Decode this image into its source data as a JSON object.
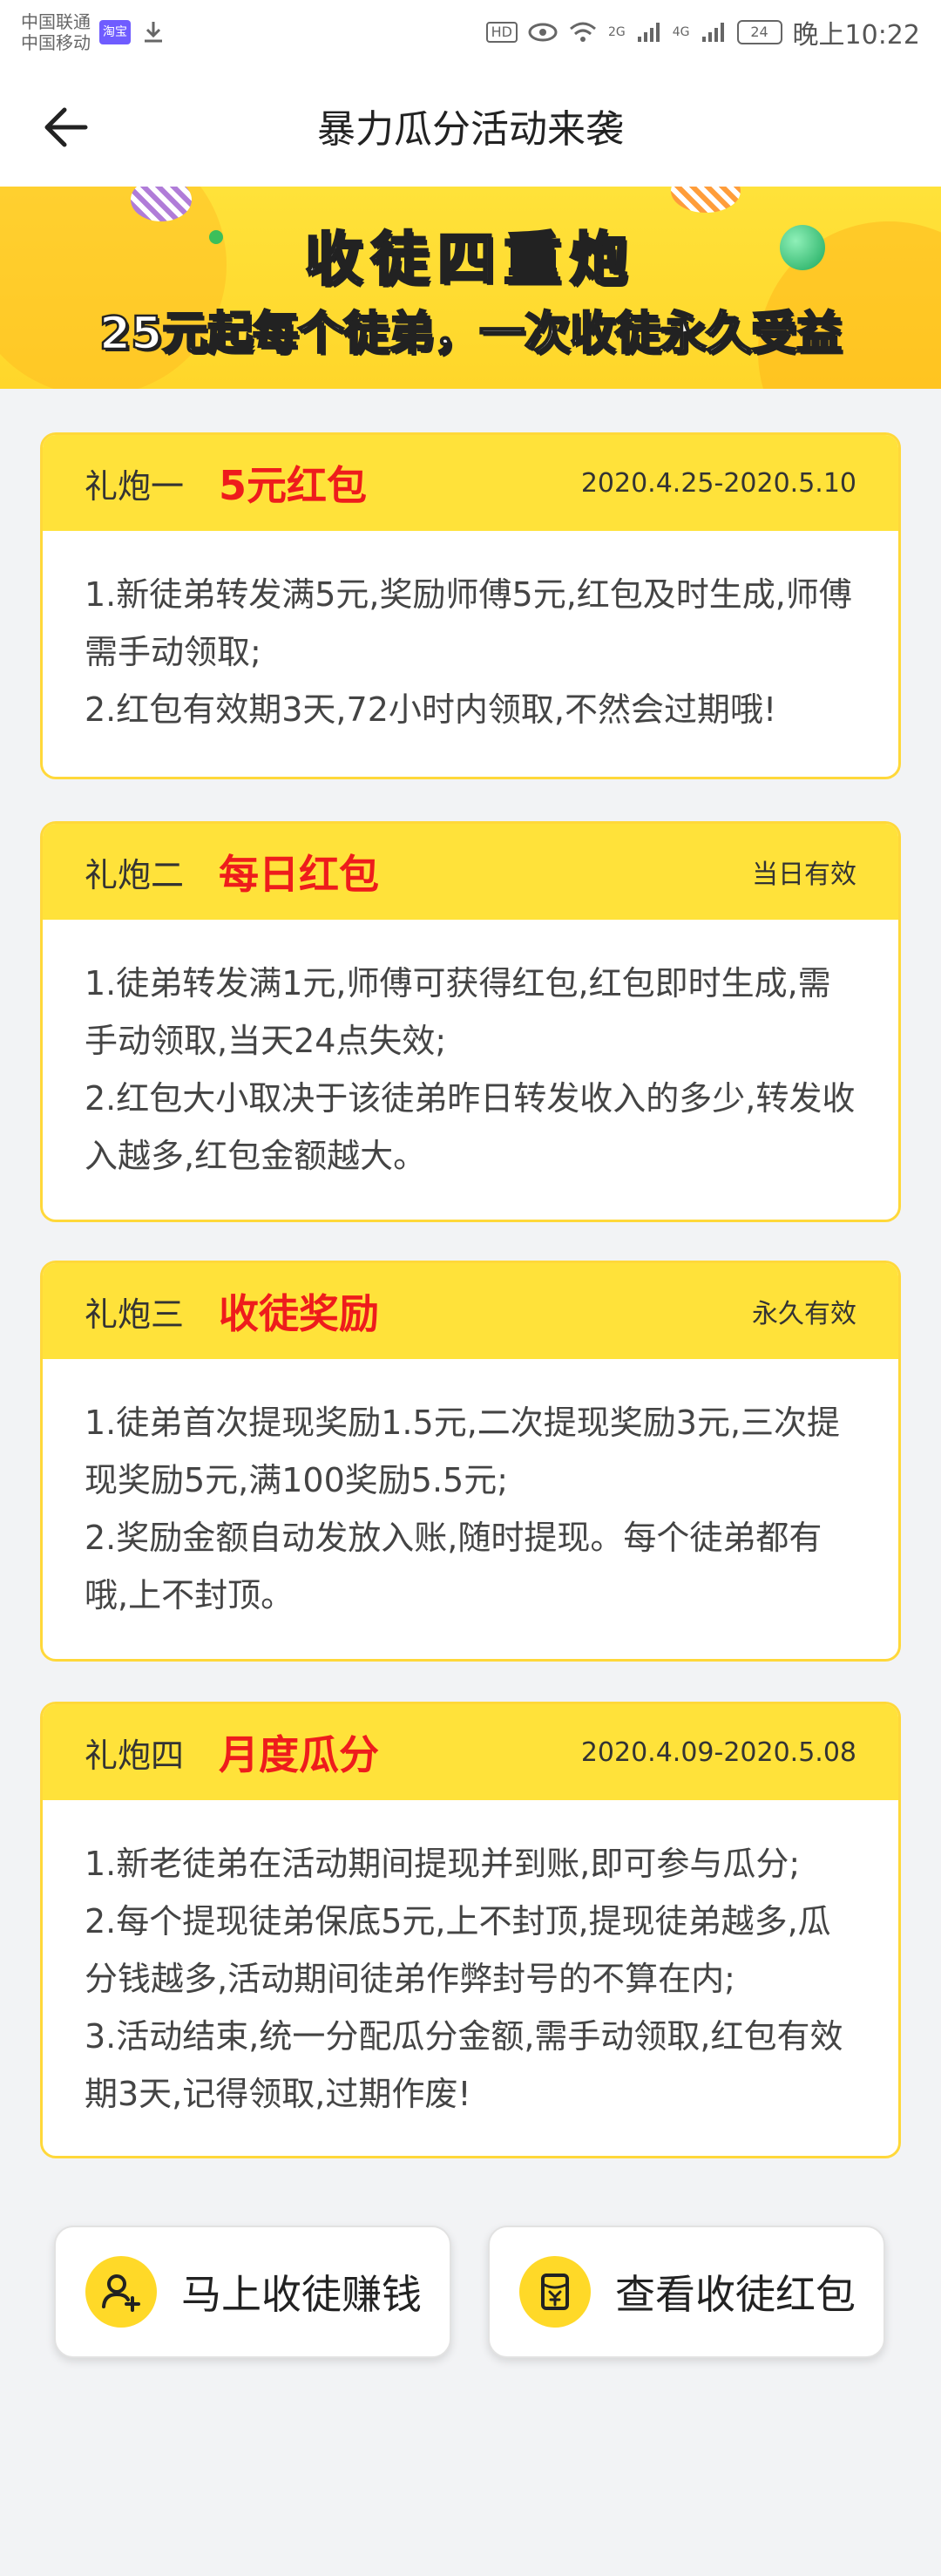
{
  "status_bar": {
    "carrier1": "中国联通",
    "carrier2": "中国移动",
    "app_badge": "淘宝",
    "network_2g": "2G",
    "network_4g": "4G",
    "battery": "24",
    "time": "晚上10:22"
  },
  "header": {
    "title": "暴力瓜分活动来袭"
  },
  "banner": {
    "title": "收徒四重炮",
    "subtitle": "25元起每个徒弟，一次收徒永久受益"
  },
  "cards": [
    {
      "label": "礼炮一",
      "title": "5元红包",
      "date": "2020.4.25-2020.5.10",
      "lines": [
        "1.新徒弟转发满5元,奖励师傅5元,红包及时生成,师傅需手动领取;",
        "2.红包有效期3天,72小时内领取,不然会过期哦!"
      ]
    },
    {
      "label": "礼炮二",
      "title": "每日红包",
      "date": "当日有效",
      "lines": [
        "1.徒弟转发满1元,师傅可获得红包,红包即时生成,需手动领取,当天24点失效;",
        "2.红包大小取决于该徒弟昨日转发收入的多少,转发收入越多,红包金额越大。"
      ]
    },
    {
      "label": "礼炮三",
      "title": "收徒奖励",
      "date": "永久有效",
      "lines": [
        "1.徒弟首次提现奖励1.5元,二次提现奖励3元,三次提现奖励5元,满100奖励5.5元;",
        "2.奖励金额自动发放入账,随时提现。每个徒弟都有哦,上不封顶。"
      ]
    },
    {
      "label": "礼炮四",
      "title": "月度瓜分",
      "date": "2020.4.09-2020.5.08",
      "lines": [
        "1.新老徒弟在活动期间提现并到账,即可参与瓜分;",
        "2.每个提现徒弟保底5元,上不封顶,提现徒弟越多,瓜分钱越多,活动期间徒弟作弊封号的不算在内;",
        "3.活动结束,统一分配瓜分金额,需手动领取,红包有效期3天,记得领取,过期作废!"
      ]
    }
  ],
  "actions": {
    "recruit_label": "马上收徒赚钱",
    "view_label": "查看收徒红包"
  },
  "colors": {
    "accent_yellow": "#ffe23a",
    "title_red": "#ee1c1c"
  }
}
